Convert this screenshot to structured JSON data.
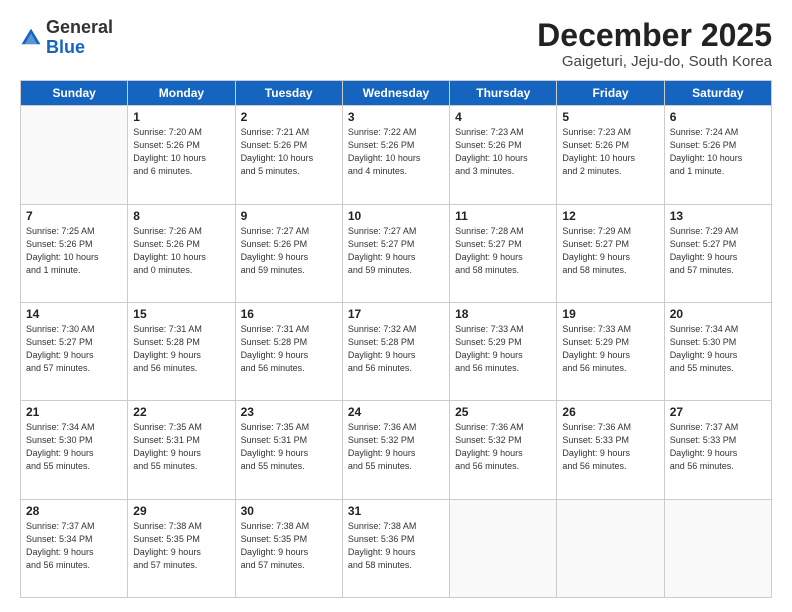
{
  "logo": {
    "general": "General",
    "blue": "Blue"
  },
  "header": {
    "month_title": "December 2025",
    "subtitle": "Gaigeturi, Jeju-do, South Korea"
  },
  "days_of_week": [
    "Sunday",
    "Monday",
    "Tuesday",
    "Wednesday",
    "Thursday",
    "Friday",
    "Saturday"
  ],
  "weeks": [
    [
      {
        "day": "",
        "info": ""
      },
      {
        "day": "1",
        "info": "Sunrise: 7:20 AM\nSunset: 5:26 PM\nDaylight: 10 hours\nand 6 minutes."
      },
      {
        "day": "2",
        "info": "Sunrise: 7:21 AM\nSunset: 5:26 PM\nDaylight: 10 hours\nand 5 minutes."
      },
      {
        "day": "3",
        "info": "Sunrise: 7:22 AM\nSunset: 5:26 PM\nDaylight: 10 hours\nand 4 minutes."
      },
      {
        "day": "4",
        "info": "Sunrise: 7:23 AM\nSunset: 5:26 PM\nDaylight: 10 hours\nand 3 minutes."
      },
      {
        "day": "5",
        "info": "Sunrise: 7:23 AM\nSunset: 5:26 PM\nDaylight: 10 hours\nand 2 minutes."
      },
      {
        "day": "6",
        "info": "Sunrise: 7:24 AM\nSunset: 5:26 PM\nDaylight: 10 hours\nand 1 minute."
      }
    ],
    [
      {
        "day": "7",
        "info": "Sunrise: 7:25 AM\nSunset: 5:26 PM\nDaylight: 10 hours\nand 1 minute."
      },
      {
        "day": "8",
        "info": "Sunrise: 7:26 AM\nSunset: 5:26 PM\nDaylight: 10 hours\nand 0 minutes."
      },
      {
        "day": "9",
        "info": "Sunrise: 7:27 AM\nSunset: 5:26 PM\nDaylight: 9 hours\nand 59 minutes."
      },
      {
        "day": "10",
        "info": "Sunrise: 7:27 AM\nSunset: 5:27 PM\nDaylight: 9 hours\nand 59 minutes."
      },
      {
        "day": "11",
        "info": "Sunrise: 7:28 AM\nSunset: 5:27 PM\nDaylight: 9 hours\nand 58 minutes."
      },
      {
        "day": "12",
        "info": "Sunrise: 7:29 AM\nSunset: 5:27 PM\nDaylight: 9 hours\nand 58 minutes."
      },
      {
        "day": "13",
        "info": "Sunrise: 7:29 AM\nSunset: 5:27 PM\nDaylight: 9 hours\nand 57 minutes."
      }
    ],
    [
      {
        "day": "14",
        "info": "Sunrise: 7:30 AM\nSunset: 5:27 PM\nDaylight: 9 hours\nand 57 minutes."
      },
      {
        "day": "15",
        "info": "Sunrise: 7:31 AM\nSunset: 5:28 PM\nDaylight: 9 hours\nand 56 minutes."
      },
      {
        "day": "16",
        "info": "Sunrise: 7:31 AM\nSunset: 5:28 PM\nDaylight: 9 hours\nand 56 minutes."
      },
      {
        "day": "17",
        "info": "Sunrise: 7:32 AM\nSunset: 5:28 PM\nDaylight: 9 hours\nand 56 minutes."
      },
      {
        "day": "18",
        "info": "Sunrise: 7:33 AM\nSunset: 5:29 PM\nDaylight: 9 hours\nand 56 minutes."
      },
      {
        "day": "19",
        "info": "Sunrise: 7:33 AM\nSunset: 5:29 PM\nDaylight: 9 hours\nand 56 minutes."
      },
      {
        "day": "20",
        "info": "Sunrise: 7:34 AM\nSunset: 5:30 PM\nDaylight: 9 hours\nand 55 minutes."
      }
    ],
    [
      {
        "day": "21",
        "info": "Sunrise: 7:34 AM\nSunset: 5:30 PM\nDaylight: 9 hours\nand 55 minutes."
      },
      {
        "day": "22",
        "info": "Sunrise: 7:35 AM\nSunset: 5:31 PM\nDaylight: 9 hours\nand 55 minutes."
      },
      {
        "day": "23",
        "info": "Sunrise: 7:35 AM\nSunset: 5:31 PM\nDaylight: 9 hours\nand 55 minutes."
      },
      {
        "day": "24",
        "info": "Sunrise: 7:36 AM\nSunset: 5:32 PM\nDaylight: 9 hours\nand 55 minutes."
      },
      {
        "day": "25",
        "info": "Sunrise: 7:36 AM\nSunset: 5:32 PM\nDaylight: 9 hours\nand 56 minutes."
      },
      {
        "day": "26",
        "info": "Sunrise: 7:36 AM\nSunset: 5:33 PM\nDaylight: 9 hours\nand 56 minutes."
      },
      {
        "day": "27",
        "info": "Sunrise: 7:37 AM\nSunset: 5:33 PM\nDaylight: 9 hours\nand 56 minutes."
      }
    ],
    [
      {
        "day": "28",
        "info": "Sunrise: 7:37 AM\nSunset: 5:34 PM\nDaylight: 9 hours\nand 56 minutes."
      },
      {
        "day": "29",
        "info": "Sunrise: 7:38 AM\nSunset: 5:35 PM\nDaylight: 9 hours\nand 57 minutes."
      },
      {
        "day": "30",
        "info": "Sunrise: 7:38 AM\nSunset: 5:35 PM\nDaylight: 9 hours\nand 57 minutes."
      },
      {
        "day": "31",
        "info": "Sunrise: 7:38 AM\nSunset: 5:36 PM\nDaylight: 9 hours\nand 58 minutes."
      },
      {
        "day": "",
        "info": ""
      },
      {
        "day": "",
        "info": ""
      },
      {
        "day": "",
        "info": ""
      }
    ]
  ]
}
